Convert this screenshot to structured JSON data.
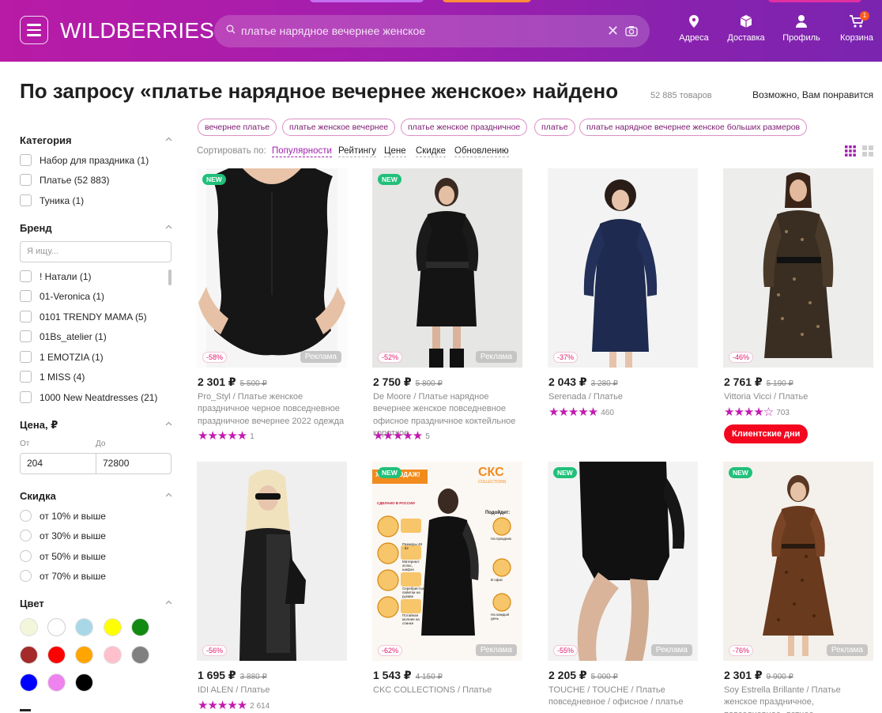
{
  "header": {
    "logo": "WILDBERRIES",
    "search_value": "платье нарядное вечернее женское",
    "nav": [
      {
        "label": "Адреса",
        "icon": "location-icon"
      },
      {
        "label": "Доставка",
        "icon": "box-icon"
      },
      {
        "label": "Профиль",
        "icon": "user-icon"
      },
      {
        "label": "Корзина",
        "icon": "cart-icon",
        "badge": "1"
      }
    ]
  },
  "page": {
    "title": "По запросу «платье нарядное вечернее женское» найдено",
    "count": "52 885 товаров",
    "maybe_like": "Возможно, Вам понравится"
  },
  "filters": {
    "category_title": "Категория",
    "categories": [
      "Набор для праздника (1)",
      "Платье (52 883)",
      "Туника (1)"
    ],
    "brand_title": "Бренд",
    "brand_placeholder": "Я ищу...",
    "brands": [
      "! Натали (1)",
      "01-Veronica (1)",
      "0101 TRENDY MAMA (5)",
      "01Bs_atelier (1)",
      "1 EMOTZIA (1)",
      "1 MISS (4)",
      "1000 New Neatdresses (21)"
    ],
    "price_title": "Цена, ₽",
    "price_from_label": "От",
    "price_to_label": "До",
    "price_from": "204",
    "price_to": "72800",
    "discount_title": "Скидка",
    "discounts": [
      "от 10% и выше",
      "от 30% и выше",
      "от 50% и выше",
      "от 70% и выше"
    ],
    "color_title": "Цвет",
    "colors": [
      "#f4f6dc",
      "#ffffff",
      "#a8d8e8",
      "#ffff00",
      "#118a11",
      "#a52a2a",
      "#ff0000",
      "#ffa500",
      "#ffc0cb",
      "#808080",
      "#0000ff",
      "#ee82ee",
      "#000000"
    ]
  },
  "chips": [
    "вечернее платье",
    "платье женское вечернее",
    "платье женское праздничное",
    "платье",
    "платье нарядное вечернее женское больших размеров"
  ],
  "sort": {
    "label": "Сортировать по:",
    "options": [
      "Популярности",
      "Рейтингу",
      "Цене",
      "Скидке",
      "Обновлению"
    ]
  },
  "products": [
    {
      "price": "2 301 ₽",
      "old": "5 500 ₽",
      "discount": "-58%",
      "brand": "Pro_Styl",
      "name": "Платье женское праздничное черное повседневное праздничное вечернее 2022 одежда",
      "stars": "★★★★★",
      "reviews": "1",
      "new": "NEW",
      "ad": "Реклама"
    },
    {
      "price": "2 750 ₽",
      "old": "5 800 ₽",
      "discount": "-52%",
      "brand": "De Moore",
      "name": "Платье нарядное вечернее женское повседневное офисное праздничное коктейльное короткое",
      "stars": "★★★★★",
      "reviews": "5",
      "new": "NEW",
      "ad": "Реклама"
    },
    {
      "price": "2 043 ₽",
      "old": "3 280 ₽",
      "discount": "-37%",
      "brand": "Serenada",
      "name": "Платье",
      "stars": "★★★★★",
      "reviews": "460",
      "new": "",
      "ad": ""
    },
    {
      "price": "2 761 ₽",
      "old": "5 190 ₽",
      "discount": "-46%",
      "brand": "Vittoria Vicci",
      "name": "Платье",
      "stars": "★★★★☆",
      "reviews": "703",
      "new": "",
      "ad": "",
      "promo": "Клиентские дни"
    },
    {
      "price": "1 695 ₽",
      "old": "3 880 ₽",
      "discount": "-56%",
      "brand": "IDI ALEN",
      "name": "Платье",
      "stars": "★★★★★",
      "reviews": "2 614",
      "new": "",
      "ad": ""
    },
    {
      "price": "1 543 ₽",
      "old": "4 150 ₽",
      "discount": "-62%",
      "brand": "CKC COLLECTIONS",
      "name": "Платье",
      "stars": "",
      "reviews": "",
      "new": "NEW",
      "ad": "Реклама",
      "poster": {
        "hit": "ХИТ ПРОДАЖ!",
        "logo": "СКС",
        "logo_sub": "COLLECTIONS",
        "made": "СДЕЛАНО В РОССИИ",
        "suits": "Подойдет:",
        "feat1": "Размеры 48 - 62",
        "feat2": "Материал: атлас, шифон",
        "feat3": "Серебристые пайетки на рукаве",
        "feat4": "Потайная молния на спинке",
        "use1": "На праздник",
        "use2": "В офис",
        "use3": "На каждый день"
      }
    },
    {
      "price": "2 205 ₽",
      "old": "5 000 ₽",
      "discount": "-55%",
      "brand": "TOUCHE / TOUCHE",
      "name": "Платье повседневное / офисное / платье",
      "stars": "",
      "reviews": "",
      "new": "NEW",
      "ad": "Реклама"
    },
    {
      "price": "2 301 ₽",
      "old": "9 900 ₽",
      "discount": "-76%",
      "brand": "Soy Estrella Brillante",
      "name": "Платье женское праздничное, повседневное, летнее,",
      "stars": "",
      "reviews": "",
      "new": "NEW",
      "ad": "Реклама"
    }
  ]
}
